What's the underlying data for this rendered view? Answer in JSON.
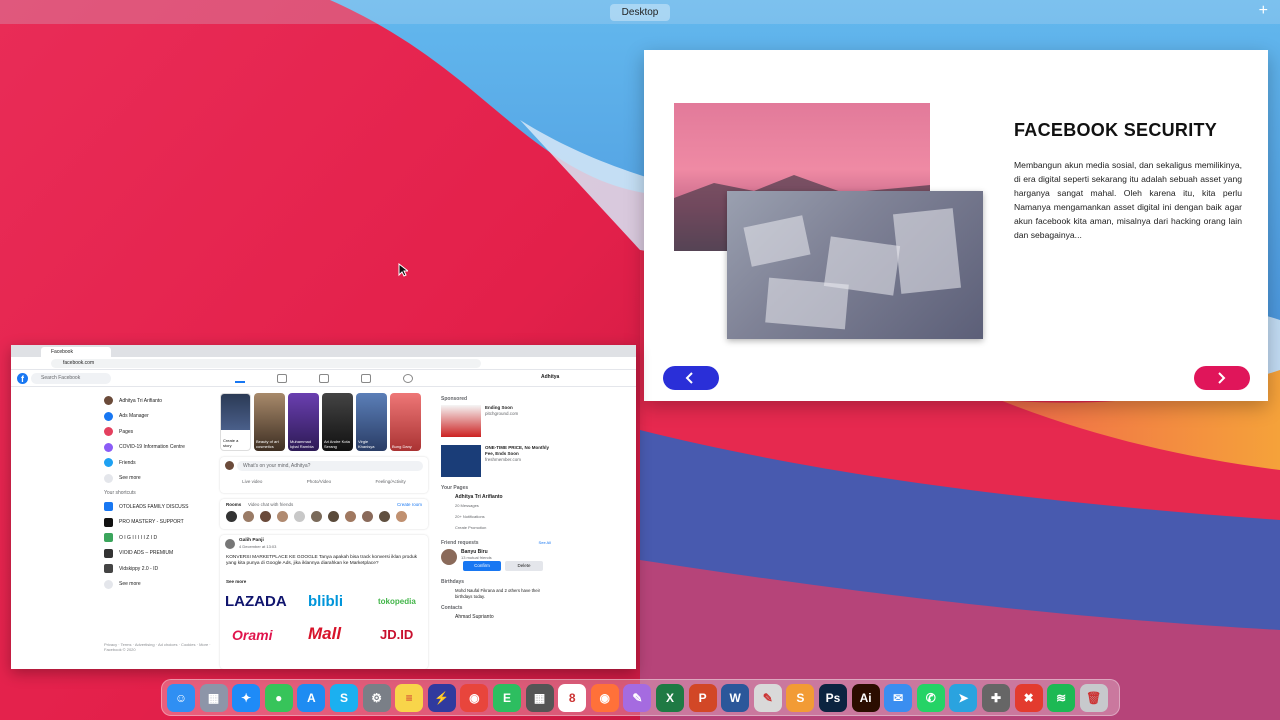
{
  "desktop": {
    "title": "Desktop"
  },
  "slide": {
    "title": "FACEBOOK SECURITY",
    "body": "Membangun akun media sosial, dan sekaligus memilikinya, di era digital seperti sekarang itu adalah sebuah asset yang harganya sangat mahal. Oleh karena itu, kita perlu Namanya mengamankan asset digital ini dengan baik agar akun facebook kita aman, misalnya dari hacking orang lain dan sebagainya...",
    "colors": {
      "prev": "#2a2fd8",
      "next": "#e0155a"
    }
  },
  "browser": {
    "tab": "Facebook",
    "url": "facebook.com",
    "search_placeholder": "Search Facebook",
    "user": "Adhitya",
    "left_menu": [
      "Adhitya Tri Arifianto",
      "Ads Manager",
      "Pages",
      "COVID-19 Information Centre",
      "Friends",
      "See more"
    ],
    "shortcuts_title": "Your shortcuts",
    "shortcuts": [
      "OTOLEADS FAMILY DISCUSS",
      "PRO MASTERY - SUPPORT",
      "O I G I I I I I Z I D",
      "VIOID ADS – PREMIUM",
      "Vidskippy 2.0 - ID",
      "See more"
    ],
    "footer": "Privacy · Terms · Advertising · Ad choices · Cookies · More · Facebook © 2020",
    "stories": [
      "Create a story",
      "Beauty of art cosmetics",
      "Muhammad Iqbal Rambia",
      "Ari Andre Kota Serang",
      "Virgie Khanisya",
      "Bung Dany"
    ],
    "composer_placeholder": "What's on your mind, Adhitya?",
    "composer_actions": [
      "Live video",
      "Photo/Video",
      "Feeling/Activity"
    ],
    "rooms": {
      "label": "Rooms",
      "sub": "Video chat with friends",
      "create": "Create room"
    },
    "post": {
      "author": "Galih Panji",
      "time": "4 December at 13:03",
      "text": "KONVERSI MARKETPLACE KE GOOGLE Tanya apakah bisa track konversi iklan produk yang kita punya di Google Ads, jika iklannya diarahkan ke Marketplace?",
      "see_more": "See more",
      "brands": [
        "LAZADA",
        "blibli",
        "tokopedia",
        "Orami",
        "Mall",
        "JD.ID"
      ]
    },
    "right": {
      "sponsored": "Sponsored",
      "ads": [
        {
          "title": "Ending Soon",
          "sub": "pitchground.com"
        },
        {
          "title": "ONE-TIME PRICE, No Monthly Fee, Ends Soon",
          "sub": "freshmember.com"
        }
      ],
      "your_pages": "Your Pages",
      "page_name": "Adhitya Tri Arifianto",
      "page_stats": [
        "20 Messages",
        "20+ Notifications",
        "Create Promotion"
      ],
      "friend_requests": "Friend requests",
      "see_all": "See All",
      "requester": "Banyu Biru",
      "mutual": "13 mutual friends",
      "confirm": "Confirm",
      "delete": "Delete",
      "birthdays": "Birthdays",
      "birthday_text": "Mohd Naufal Fikrana and 2 others have their birthdays today.",
      "contacts": "Contacts",
      "contact_name": "Ahmad Suprianto"
    }
  },
  "dock": {
    "apps": [
      {
        "name": "Finder",
        "color": "#2f8ff3",
        "glyph": "☺"
      },
      {
        "name": "Launchpad",
        "color": "#8d95a8",
        "glyph": "▦"
      },
      {
        "name": "Safari",
        "color": "#1e8bf7",
        "glyph": "✦"
      },
      {
        "name": "Messages",
        "color": "#37c45a",
        "glyph": "●"
      },
      {
        "name": "App Store",
        "color": "#1e8cf2",
        "glyph": "A"
      },
      {
        "name": "Skype",
        "color": "#1bb0f0",
        "glyph": "S"
      },
      {
        "name": "System Preferences",
        "color": "#7a7f87",
        "glyph": "⚙"
      },
      {
        "name": "Notes",
        "color": "#f8d54a",
        "glyph": "≡"
      },
      {
        "name": "Speedy",
        "color": "#303a9e",
        "glyph": "⚡"
      },
      {
        "name": "Chrome",
        "color": "#e8453c",
        "glyph": "◉"
      },
      {
        "name": "Evernote",
        "color": "#2dbe60",
        "glyph": "E"
      },
      {
        "name": "Calculator",
        "color": "#555555",
        "glyph": "▦"
      },
      {
        "name": "Calendar",
        "color": "#ffffff",
        "glyph": "8"
      },
      {
        "name": "Firefox",
        "color": "#ff7139",
        "glyph": "◉"
      },
      {
        "name": "Quill",
        "color": "#a56be0",
        "glyph": "✎"
      },
      {
        "name": "Excel",
        "color": "#1f7a44",
        "glyph": "X"
      },
      {
        "name": "PowerPoint",
        "color": "#d24726",
        "glyph": "P"
      },
      {
        "name": "Word",
        "color": "#2b579a",
        "glyph": "W"
      },
      {
        "name": "Script Editor",
        "color": "#d9d9d9",
        "glyph": "✎"
      },
      {
        "name": "Sublime",
        "color": "#f29b35",
        "glyph": "S"
      },
      {
        "name": "Photoshop",
        "color": "#0b2440",
        "glyph": "Ps"
      },
      {
        "name": "Illustrator",
        "color": "#2b0d00",
        "glyph": "Ai"
      },
      {
        "name": "Mail",
        "color": "#3a8ef0",
        "glyph": "✉"
      },
      {
        "name": "WhatsApp",
        "color": "#25d366",
        "glyph": "✆"
      },
      {
        "name": "Telegram",
        "color": "#2aa3df",
        "glyph": "➤"
      },
      {
        "name": "Game Controller",
        "color": "#666666",
        "glyph": "✚"
      },
      {
        "name": "Toolbox",
        "color": "#e33b2e",
        "glyph": "✖"
      },
      {
        "name": "Spotify",
        "color": "#1db954",
        "glyph": "≋"
      },
      {
        "name": "Trash",
        "color": "#c7c9cc",
        "glyph": "🗑"
      }
    ]
  }
}
